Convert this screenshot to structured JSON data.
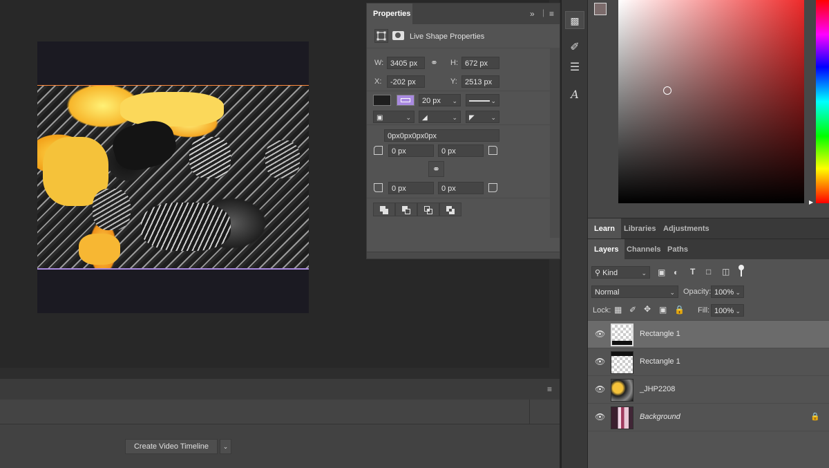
{
  "properties": {
    "tab": "Properties",
    "section_title": "Live Shape Properties",
    "w_label": "W:",
    "w_value": "3405 px",
    "h_label": "H:",
    "h_value": "672 px",
    "x_label": "X:",
    "x_value": "-202 px",
    "y_label": "Y:",
    "y_value": "2513 px",
    "stroke_width": "20 px",
    "corner_all": "0px0px0px0px",
    "corner_tl": "0 px",
    "corner_tr": "0 px",
    "corner_bl": "0 px",
    "corner_br": "0 px",
    "colors": {
      "fill": "#1e1e1e",
      "stroke": "#a98ae0"
    }
  },
  "learn_tabs": [
    "Learn",
    "Libraries",
    "Adjustments"
  ],
  "layer_tabs": [
    "Layers",
    "Channels",
    "Paths"
  ],
  "layers_panel": {
    "filter_kind": "Kind",
    "blend_mode": "Normal",
    "opacity_label": "Opacity:",
    "opacity_value": "100%",
    "lock_label": "Lock:",
    "fill_label": "Fill:",
    "fill_value": "100%",
    "layers": [
      {
        "name": "Rectangle 1",
        "selected": true
      },
      {
        "name": "Rectangle 1",
        "selected": false
      },
      {
        "name": "_JHP2208",
        "selected": false
      },
      {
        "name": "Background",
        "selected": false
      }
    ]
  },
  "timeline": {
    "create_button": "Create Video Timeline"
  }
}
